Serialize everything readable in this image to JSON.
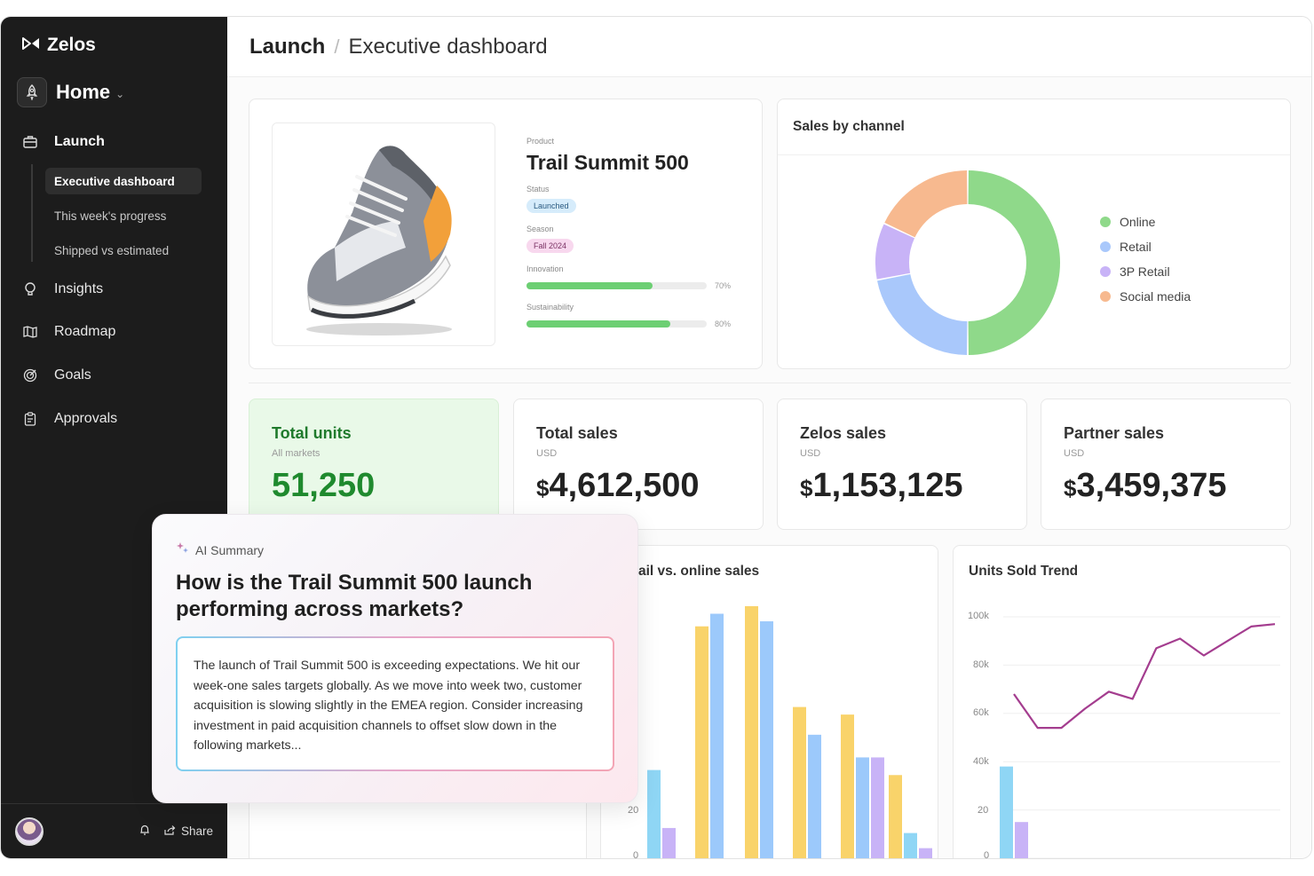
{
  "app": {
    "name": "Zelos"
  },
  "workspace": {
    "label": "Home"
  },
  "nav": {
    "launch": "Launch",
    "subitems": [
      "Executive dashboard",
      "This week's progress",
      "Shipped vs estimated"
    ],
    "insights": "Insights",
    "roadmap": "Roadmap",
    "goals": "Goals",
    "approvals": "Approvals"
  },
  "footer": {
    "share": "Share"
  },
  "breadcrumb": {
    "section": "Launch",
    "sep": "/",
    "page": "Executive dashboard"
  },
  "product": {
    "label": "Product",
    "name": "Trail Summit 500",
    "status_label": "Status",
    "status": "Launched",
    "season_label": "Season",
    "season": "Fall 2024",
    "innovation_label": "Innovation",
    "innovation_pct": "70%",
    "innovation_value": 0.7,
    "sustainability_label": "Sustainability",
    "sustainability_pct": "80%",
    "sustainability_value": 0.8
  },
  "sales_by_channel": {
    "title": "Sales by channel",
    "legend": [
      "Online",
      "Retail",
      "3P Retail",
      "Social media"
    ],
    "colors": [
      "#8fd98a",
      "#a9c8fb",
      "#c8b3f7",
      "#f7b98f"
    ]
  },
  "kpis": [
    {
      "title": "Total units",
      "sub": "All markets",
      "value": "51,250",
      "currency": ""
    },
    {
      "title": "Total sales",
      "sub": "USD",
      "value": "4,612,500",
      "currency": "$"
    },
    {
      "title": "Zelos sales",
      "sub": "USD",
      "value": "1,153,125",
      "currency": "$"
    },
    {
      "title": "Partner sales",
      "sub": "USD",
      "value": "3,459,375",
      "currency": "$"
    }
  ],
  "retail_chart": {
    "title": "ail vs. online sales",
    "tick_20": "20",
    "tick_0": "0"
  },
  "units_trend": {
    "title": "Units Sold Trend",
    "ticks": [
      "100k",
      "80k",
      "60k",
      "40k",
      "20"
    ],
    "tick_0": "0"
  },
  "ai_summary": {
    "label": "AI Summary",
    "question": "How is the Trail Summit 500 launch performing across markets?",
    "answer": "The launch of Trail Summit 500 is exceeding expectations. We hit our week-one sales targets globally. As we move into week two, customer acquisition is slowing slightly in the EMEA region. Consider increasing investment in paid acquisition channels to offset slow down in the following markets..."
  },
  "chart_data": [
    {
      "type": "pie",
      "title": "Sales by channel",
      "categories": [
        "Online",
        "Retail",
        "3P Retail",
        "Social media"
      ],
      "values": [
        50,
        22,
        10,
        18
      ]
    },
    {
      "type": "bar",
      "title": "ail vs. online sales",
      "series": [
        {
          "values": [
            null,
            92,
            100,
            60,
            57,
            33
          ]
        },
        {
          "values": [
            35,
            97,
            94,
            49,
            40,
            10
          ]
        },
        {
          "values": [
            12,
            null,
            null,
            null,
            40,
            4
          ]
        }
      ]
    },
    {
      "type": "line",
      "title": "Units Sold Trend",
      "ylim": [
        0,
        100000
      ],
      "line": [
        68000,
        54000,
        54000,
        62000,
        69000,
        66000,
        87000,
        91000,
        84000,
        90000,
        96000,
        97000
      ],
      "bars": [
        {
          "values": [
            38000
          ]
        },
        {
          "values": [
            15000
          ]
        }
      ]
    }
  ]
}
